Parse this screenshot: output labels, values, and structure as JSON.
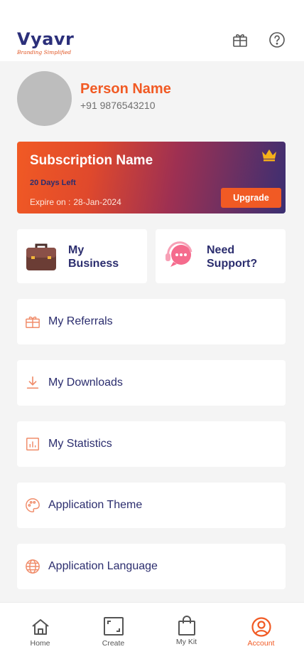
{
  "header": {
    "logo": "Vyavr",
    "tagline": "Branding Simplified",
    "gift_icon": "gift-icon",
    "help_icon": "help-circle-icon"
  },
  "profile": {
    "name": "Person Name",
    "phone": "+91 9876543210"
  },
  "subscription": {
    "name": "Subscription Name",
    "days_left": "20 Days Left",
    "expire_label": "Expire on :",
    "expire_date": "28-Jan-2024",
    "upgrade_label": "Upgrade",
    "crown_icon": "crown-icon"
  },
  "tiles": {
    "business_line1": "My",
    "business_line2": "Business",
    "support_line1": "Need",
    "support_line2": "Support?"
  },
  "menu": {
    "items": [
      {
        "label": "My Referrals",
        "icon": "gift-icon"
      },
      {
        "label": "My Downloads",
        "icon": "download-icon"
      },
      {
        "label": "My Statistics",
        "icon": "chart-icon"
      },
      {
        "label": "Application Theme",
        "icon": "palette-icon"
      },
      {
        "label": "Application Language",
        "icon": "globe-icon"
      }
    ]
  },
  "nav": {
    "items": [
      {
        "label": "Home",
        "icon": "home-icon",
        "active": false
      },
      {
        "label": "Create",
        "icon": "create-icon",
        "active": false
      },
      {
        "label": "My Kit",
        "icon": "shopping-bag-icon",
        "active": false
      },
      {
        "label": "Account",
        "icon": "account-icon",
        "active": true
      }
    ]
  },
  "colors": {
    "accent": "#f15a24",
    "navy": "#2b2d6e",
    "background": "#f4f4f4"
  }
}
